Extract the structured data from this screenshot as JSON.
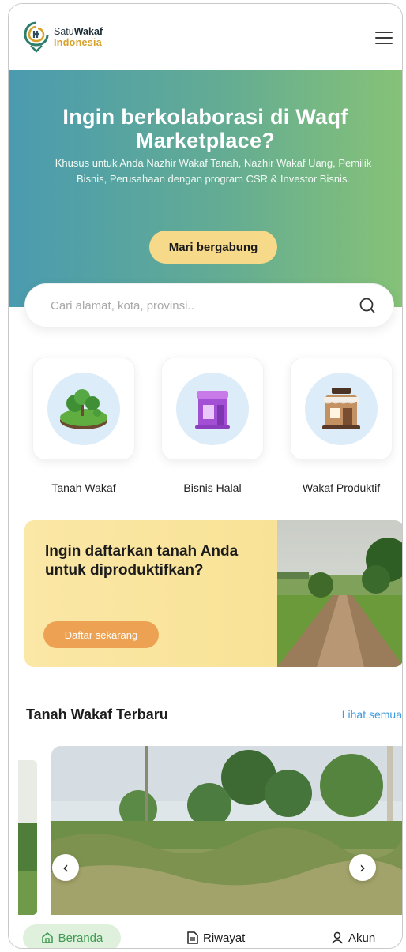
{
  "header": {
    "logo_line1_prefix": "Satu",
    "logo_line1_bold": "Wakaf",
    "logo_line2": "Indonesia",
    "menu_icon": "hamburger-menu-icon"
  },
  "hero": {
    "title": "Ingin berkolaborasi di Waqf Marketplace?",
    "subtitle": "Khusus untuk Anda Nazhir Wakaf Tanah, Nazhir Wakaf Uang, Pemilik Bisnis, Perusahaan dengan program CSR & Investor Bisnis.",
    "cta_label": "Mari bergabung",
    "gradient_colors": [
      "#4a9bb0",
      "#86c277"
    ]
  },
  "search": {
    "placeholder": "Cari alamat, kota, provinsi..",
    "icon": "search-icon"
  },
  "categories": [
    {
      "label": "Tanah Wakaf",
      "icon": "land-trees-icon"
    },
    {
      "label": "Bisnis Halal",
      "icon": "halal-shop-icon"
    },
    {
      "label": "Wakaf Produktif",
      "icon": "coffee-shop-icon"
    }
  ],
  "promo": {
    "title": "Ingin daftarkan tanah Anda untuk diproduktifkan?",
    "cta_label": "Daftar sekarang"
  },
  "latest": {
    "title": "Tanah Wakaf Terbaru",
    "see_all": "Lihat semua"
  },
  "bottom_nav": {
    "items": [
      {
        "label": "Beranda",
        "icon": "home-icon",
        "active": true
      },
      {
        "label": "Riwayat",
        "icon": "document-icon",
        "active": false
      },
      {
        "label": "Akun",
        "icon": "user-icon",
        "active": false
      }
    ]
  },
  "colors": {
    "accent_yellow": "#f7d98a",
    "accent_orange": "#eda152",
    "link_blue": "#3d9be0",
    "active_green": "#3f9a52"
  }
}
